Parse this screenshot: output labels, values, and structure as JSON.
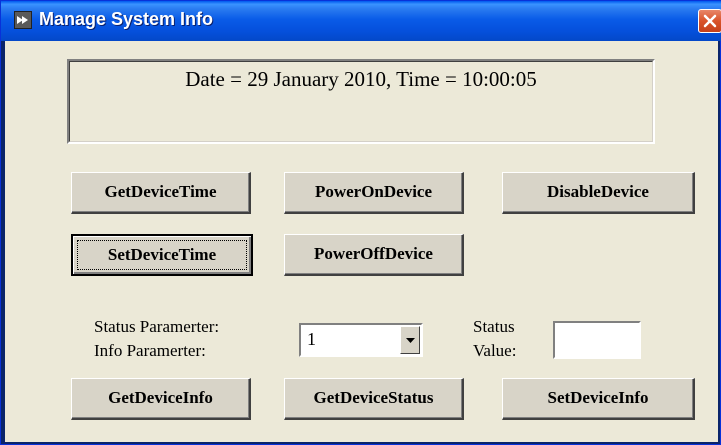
{
  "window": {
    "title": "Manage System Info",
    "icon": "app-icon",
    "close_icon": "close-icon"
  },
  "display": {
    "datetime": "Date = 29 January 2010, Time = 10:00:05"
  },
  "buttons": {
    "get_device_time": "GetDeviceTime",
    "power_on_device": "PowerOnDevice",
    "disable_device": "DisableDevice",
    "set_device_time": "SetDeviceTime",
    "power_off_device": "PowerOffDevice",
    "get_device_info": "GetDeviceInfo",
    "get_device_status": "GetDeviceStatus",
    "set_device_info": "SetDeviceInfo"
  },
  "parameters": {
    "status_label": "Status Paramerter:",
    "info_label": "Info Paramerter:",
    "selected_value": "1",
    "dropdown_icon": "chevron-down-icon",
    "value_label_1": "Status",
    "value_label_2": "Value:",
    "value_input": ""
  },
  "colors": {
    "titlebar": "#0a5ce8",
    "client_bg": "#ece9d8",
    "close": "#d9532a"
  }
}
